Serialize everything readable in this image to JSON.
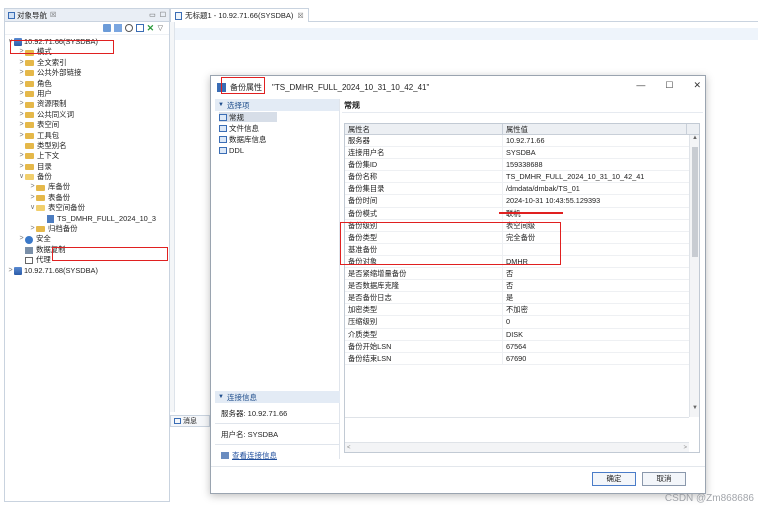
{
  "navigator": {
    "tab_title": "对象导航",
    "tab_close": "☒",
    "tree": [
      {
        "label": "10.92.71.66(SYSDBA)",
        "level": 0,
        "icon": "db",
        "twisty": "∨"
      },
      {
        "label": "模式",
        "level": 1,
        "icon": "folder",
        "twisty": ">"
      },
      {
        "label": "全文索引",
        "level": 1,
        "icon": "folder",
        "twisty": ">"
      },
      {
        "label": "公共外部链接",
        "level": 1,
        "icon": "folder",
        "twisty": ">"
      },
      {
        "label": "角色",
        "level": 1,
        "icon": "folder",
        "twisty": ">"
      },
      {
        "label": "用户",
        "level": 1,
        "icon": "folder",
        "twisty": ">"
      },
      {
        "label": "资源限制",
        "level": 1,
        "icon": "folder",
        "twisty": ">"
      },
      {
        "label": "公共同义词",
        "level": 1,
        "icon": "folder",
        "twisty": ">"
      },
      {
        "label": "表空间",
        "level": 1,
        "icon": "folder",
        "twisty": ">"
      },
      {
        "label": "工具包",
        "level": 1,
        "icon": "folder",
        "twisty": ">"
      },
      {
        "label": "类型别名",
        "level": 1,
        "icon": "folder",
        "twisty": ""
      },
      {
        "label": "上下文",
        "level": 1,
        "icon": "folder",
        "twisty": ">"
      },
      {
        "label": "目录",
        "level": 1,
        "icon": "folder",
        "twisty": ">"
      },
      {
        "label": "备份",
        "level": 1,
        "icon": "folder-open",
        "twisty": "∨"
      },
      {
        "label": "库备份",
        "level": 2,
        "icon": "folder",
        "twisty": ">"
      },
      {
        "label": "表备份",
        "level": 2,
        "icon": "folder",
        "twisty": ">"
      },
      {
        "label": "表空间备份",
        "level": 2,
        "icon": "folder-open",
        "twisty": "∨"
      },
      {
        "label": "TS_DMHR_FULL_2024_10_3",
        "level": 3,
        "icon": "backup",
        "twisty": ""
      },
      {
        "label": "归档备份",
        "level": 2,
        "icon": "folder",
        "twisty": ">"
      },
      {
        "label": "安全",
        "level": 1,
        "icon": "shield",
        "twisty": ">"
      },
      {
        "label": "数据复制",
        "level": 1,
        "icon": "repl",
        "twisty": ""
      },
      {
        "label": "代理",
        "level": 1,
        "icon": "proxy",
        "twisty": ""
      },
      {
        "label": "10.92.71.68(SYSDBA)",
        "level": 0,
        "icon": "db",
        "twisty": ">"
      }
    ]
  },
  "editor": {
    "tab_title": "无标题1 - 10.92.71.66(SYSDBA)",
    "tab_close": "☒",
    "messages_tab": "消息"
  },
  "dialog": {
    "title": "备份属性",
    "subtitle": "\"TS_DMHR_FULL_2024_10_31_10_42_41\"",
    "controls": {
      "minimize": "—",
      "maximize": "☐",
      "close": "✕"
    },
    "select_section": "选择项",
    "pages": [
      "常规",
      "文件信息",
      "数据库信息",
      "DDL"
    ],
    "selected_page": "常规",
    "right_heading": "常规",
    "grid_headers": [
      "属性名",
      "属性值"
    ],
    "properties": [
      [
        "服务器",
        "10.92.71.66"
      ],
      [
        "连接用户名",
        "SYSDBA"
      ],
      [
        "备份集ID",
        "159338688"
      ],
      [
        "备份名称",
        "TS_DMHR_FULL_2024_10_31_10_42_41"
      ],
      [
        "备份集目录",
        "/dmdata/dmbak/TS_01"
      ],
      [
        "备份时间",
        "2024-10-31 10:43:55.129393"
      ],
      [
        "备份模式",
        "联机"
      ],
      [
        "备份级别",
        "表空间级"
      ],
      [
        "备份类型",
        "完全备份"
      ],
      [
        "基准备份",
        ""
      ],
      [
        "备份对象",
        "DMHR"
      ],
      [
        "是否紧缩增量备份",
        "否"
      ],
      [
        "是否数据库克隆",
        "否"
      ],
      [
        "是否备份日志",
        "是"
      ],
      [
        "加密类型",
        "不加密"
      ],
      [
        "压缩级别",
        "0"
      ],
      [
        "介质类型",
        "DISK"
      ],
      [
        "备份开始LSN",
        "67564"
      ],
      [
        "备份结束LSN",
        "67690"
      ]
    ],
    "connection_section": "连接信息",
    "server_line": "服务器: 10.92.71.66",
    "user_line": "用户名: SYSDBA",
    "view_conn_link": "查看连接信息",
    "ok_button": "确定",
    "cancel_button": "取消"
  },
  "watermark": "CSDN @Zm868686",
  "colors": {
    "highlight_box": "#e02020",
    "accent": "#3a6db5"
  }
}
